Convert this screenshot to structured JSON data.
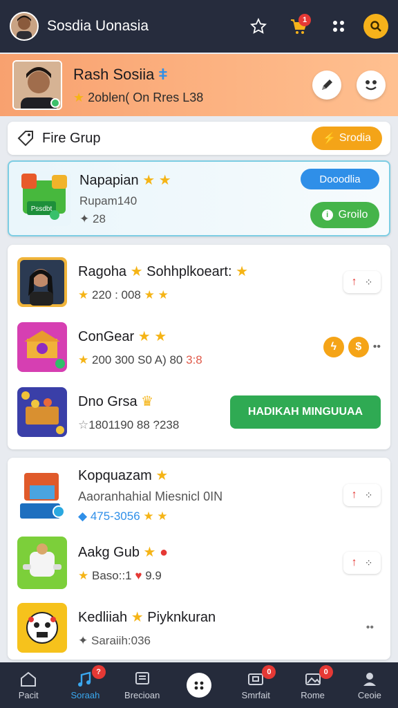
{
  "topbar": {
    "title": "Sosdia Uonasia",
    "cart_badge": "1"
  },
  "profile": {
    "name": "Rash Sosiia",
    "stats": "2oblen( On Rres L38"
  },
  "group": {
    "label": "Fire Grup",
    "button": "Srodia"
  },
  "featured": {
    "title": "Napapian",
    "sub": "Rupam140",
    "meta": "28",
    "thumb_text": "Pssdbt",
    "button_primary": "Dooodlia",
    "button_secondary": "Groilo"
  },
  "list1": [
    {
      "title": "Ragoha",
      "title2": "Sohhplkoeart:",
      "meta": "220 : 008"
    },
    {
      "title": "ConGear",
      "meta": "200 300 S0 A) 80",
      "meta_extra": "3:8"
    },
    {
      "title": "Dno Grsa",
      "meta": "1801190 88 ?238",
      "cta": "HADIKAH MINGUUAA"
    }
  ],
  "list2": [
    {
      "title": "Kopquazam",
      "sub": "Aaoranhahial Miesnicl 0IN",
      "meta": "475-3056"
    },
    {
      "title": "Aakg Gub",
      "meta": "Baso::1",
      "meta_extra": "9.9"
    },
    {
      "title": "Kedliiah",
      "title2": "Piyknkuran",
      "meta": "Saraiih:036"
    }
  ],
  "nav": [
    {
      "label": "Pacit"
    },
    {
      "label": "Soraah",
      "badge": "?"
    },
    {
      "label": "Brecioan"
    },
    {
      "label": ""
    },
    {
      "label": "Smrfait",
      "badge": "0"
    },
    {
      "label": "Rome",
      "badge": "0"
    },
    {
      "label": "Ceoie"
    }
  ],
  "colors": {
    "topbar": "#262c3d",
    "accent_orange": "#f6b21b",
    "accent_blue": "#2f8fe8",
    "accent_green": "#45b44a",
    "cta_green": "#2faa53"
  }
}
